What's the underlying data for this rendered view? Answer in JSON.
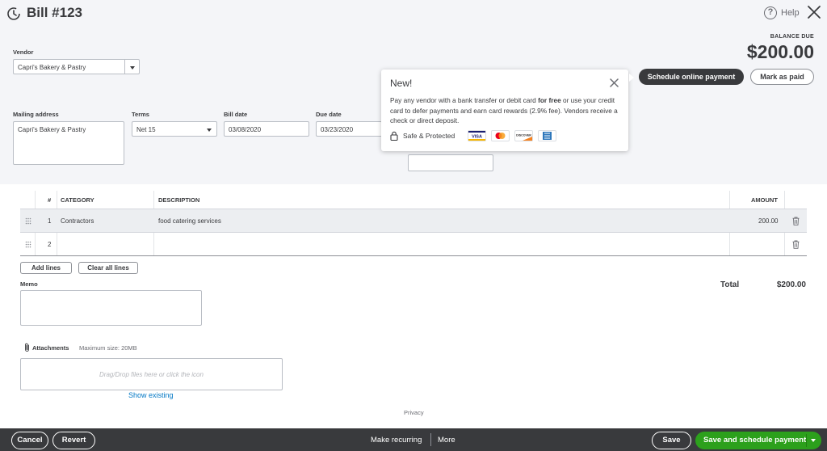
{
  "header": {
    "title": "Bill #123",
    "help_label": "Help",
    "balance_label": "BALANCE DUE",
    "balance_amount": "$200.00",
    "schedule_online_label": "Schedule online payment",
    "mark_paid_label": "Mark as paid"
  },
  "form": {
    "vendor_label": "Vendor",
    "vendor_value": "Capri's Bakery & Pastry",
    "mailing_label": "Mailing address",
    "mailing_value": "Capri's Bakery & Pastry",
    "terms_label": "Terms",
    "terms_value": "Net 15",
    "bill_date_label": "Bill date",
    "bill_date_value": "03/08/2020",
    "due_date_label": "Due date",
    "due_date_value": "03/23/2020"
  },
  "popover": {
    "title": "New!",
    "text_before": "Pay any vendor with a bank transfer or debit card ",
    "text_bold": "for free",
    "text_after": " or use your credit card to defer payments and earn card rewards (2.9% fee). Vendors receive a check or direct deposit.",
    "safe_label": "Safe & Protected",
    "cards": [
      "VISA",
      "Mastercard",
      "DISCOVER",
      "AMEX"
    ]
  },
  "table": {
    "headers": {
      "num": "#",
      "category": "CATEGORY",
      "description": "DESCRIPTION",
      "amount": "AMOUNT"
    },
    "rows": [
      {
        "num": "1",
        "category": "Contractors",
        "description": "food catering services",
        "amount": "200.00"
      },
      {
        "num": "2",
        "category": "",
        "description": "",
        "amount": ""
      }
    ]
  },
  "actions": {
    "add_lines": "Add lines",
    "clear_lines": "Clear all lines"
  },
  "memo": {
    "label": "Memo"
  },
  "totals": {
    "label": "Total",
    "value": "$200.00"
  },
  "attachments": {
    "label": "Attachments",
    "max_size": "Maximum size: 20MB",
    "drop_text": "Drag/Drop files here or click the icon",
    "show_existing": "Show existing"
  },
  "privacy": "Privacy",
  "footer": {
    "cancel": "Cancel",
    "revert": "Revert",
    "make_recurring": "Make recurring",
    "more": "More",
    "save": "Save",
    "save_schedule": "Save and schedule payment"
  },
  "colors": {
    "accent_green": "#2ca01c",
    "dark": "#393a3d",
    "link_blue": "#0077c5",
    "header_bg": "#f4f5f8"
  }
}
